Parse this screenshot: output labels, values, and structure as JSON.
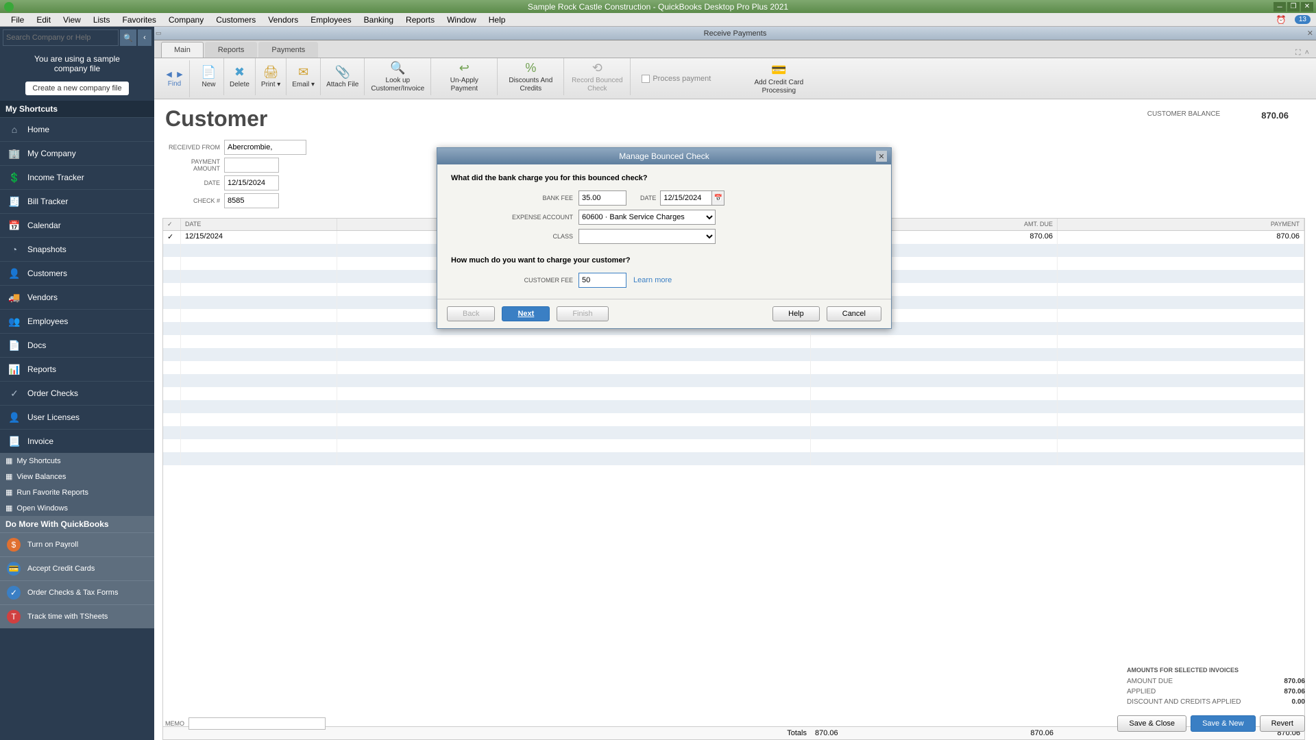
{
  "titlebar": {
    "text": "Sample Rock Castle Construction  - QuickBooks Desktop Pro Plus 2021"
  },
  "menubar": {
    "items": [
      "File",
      "Edit",
      "View",
      "Lists",
      "Favorites",
      "Company",
      "Customers",
      "Vendors",
      "Employees",
      "Banking",
      "Reports",
      "Window",
      "Help"
    ],
    "notif_count": "13"
  },
  "sidebar": {
    "search_placeholder": "Search Company or Help",
    "notice_line1": "You are using a sample",
    "notice_line2": "company file",
    "new_company_btn": "Create a new company file",
    "sec1": "My Shortcuts",
    "nav": [
      {
        "icon": "⌂",
        "label": "Home"
      },
      {
        "icon": "🏢",
        "label": "My Company"
      },
      {
        "icon": "💲",
        "label": "Income Tracker"
      },
      {
        "icon": "🧾",
        "label": "Bill Tracker"
      },
      {
        "icon": "📅",
        "label": "Calendar"
      },
      {
        "icon": "◔",
        "label": "Snapshots"
      },
      {
        "icon": "👤",
        "label": "Customers"
      },
      {
        "icon": "🚚",
        "label": "Vendors"
      },
      {
        "icon": "👥",
        "label": "Employees"
      },
      {
        "icon": "📄",
        "label": "Docs"
      },
      {
        "icon": "📊",
        "label": "Reports"
      },
      {
        "icon": "✓",
        "label": "Order Checks"
      },
      {
        "icon": "👤",
        "label": "User Licenses"
      },
      {
        "icon": "📃",
        "label": "Invoice"
      }
    ],
    "sec2_items": [
      "My Shortcuts",
      "View Balances",
      "Run Favorite Reports",
      "Open Windows"
    ],
    "sec3": "Do More With QuickBooks",
    "actions": [
      {
        "bg": "#e07030",
        "icon": "$",
        "label": "Turn on Payroll"
      },
      {
        "bg": "#3a7fc4",
        "icon": "💳",
        "label": "Accept Credit Cards"
      },
      {
        "bg": "#3a7fc4",
        "icon": "✓",
        "label": "Order Checks & Tax Forms"
      },
      {
        "bg": "#d04040",
        "icon": "T",
        "label": "Track time with TSheets"
      }
    ]
  },
  "subwindow": {
    "title": "Receive Payments"
  },
  "tabs": [
    "Main",
    "Reports",
    "Payments"
  ],
  "toolbar": {
    "find": "Find",
    "items": [
      {
        "icon": "📄",
        "label": "New",
        "color": "#3a7fc4"
      },
      {
        "icon": "✖",
        "label": "Delete",
        "color": "#4aa0d0"
      },
      {
        "icon": "🖨",
        "label": "Print",
        "color": "#d0a030",
        "drop": true
      },
      {
        "icon": "✉",
        "label": "Email",
        "color": "#d0a030",
        "drop": true
      },
      {
        "icon": "📎",
        "label": "Attach File",
        "color": "#70a050"
      },
      {
        "icon": "🔍",
        "label": "Look up Customer/Invoice",
        "color": "#70a050"
      },
      {
        "icon": "↩",
        "label": "Un-Apply Payment",
        "color": "#70a050"
      },
      {
        "icon": "%",
        "label": "Discounts And Credits",
        "color": "#70a050"
      },
      {
        "icon": "⟲",
        "label": "Record Bounced Check",
        "color": "#aaa",
        "disabled": true
      }
    ],
    "process_payment": "Process payment",
    "add_cc": "Add Credit Card Processing"
  },
  "form": {
    "heading": "Customer",
    "balance_label": "CUSTOMER BALANCE",
    "balance_value": "870.06",
    "received_from_label": "RECEIVED FROM",
    "received_from": "Abercrombie,",
    "payment_amount_label": "PAYMENT AMOUNT",
    "date_label": "DATE",
    "date": "12/15/2024",
    "check_label": "CHECK #",
    "check": "8585"
  },
  "grid": {
    "cols": {
      "chk": "✓",
      "date": "DATE",
      "amtdue": "AMT. DUE",
      "payment": "PAYMENT"
    },
    "row": {
      "chk": "✓",
      "date": "12/15/2024",
      "amtdue": "870.06",
      "mid": "870.06",
      "payment": "870.06"
    },
    "totals_label": "Totals",
    "totals_amtdue": "870.06",
    "totals_mid": "870.06",
    "totals_payment": "870.06"
  },
  "summary": {
    "header": "AMOUNTS FOR SELECTED INVOICES",
    "rows": [
      {
        "label": "AMOUNT DUE",
        "value": "870.06"
      },
      {
        "label": "APPLIED",
        "value": "870.06"
      },
      {
        "label": "DISCOUNT AND CREDITS APPLIED",
        "value": "0.00"
      }
    ]
  },
  "footer": {
    "memo_label": "MEMO",
    "save_close": "Save & Close",
    "save_new": "Save & New",
    "revert": "Revert"
  },
  "dialog": {
    "title": "Manage Bounced Check",
    "q1": "What did the bank charge you for this bounced check?",
    "bank_fee_label": "BANK FEE",
    "bank_fee": "35.00",
    "date_label": "DATE",
    "date": "12/15/2024",
    "expense_label": "EXPENSE ACCOUNT",
    "expense": "60600 · Bank Service Charges",
    "class_label": "CLASS",
    "q2": "How much do you want to charge your customer?",
    "cust_fee_label": "CUSTOMER FEE",
    "cust_fee": "50",
    "learn": "Learn more",
    "back": "Back",
    "next": "Next",
    "finish": "Finish",
    "help": "Help",
    "cancel": "Cancel"
  }
}
